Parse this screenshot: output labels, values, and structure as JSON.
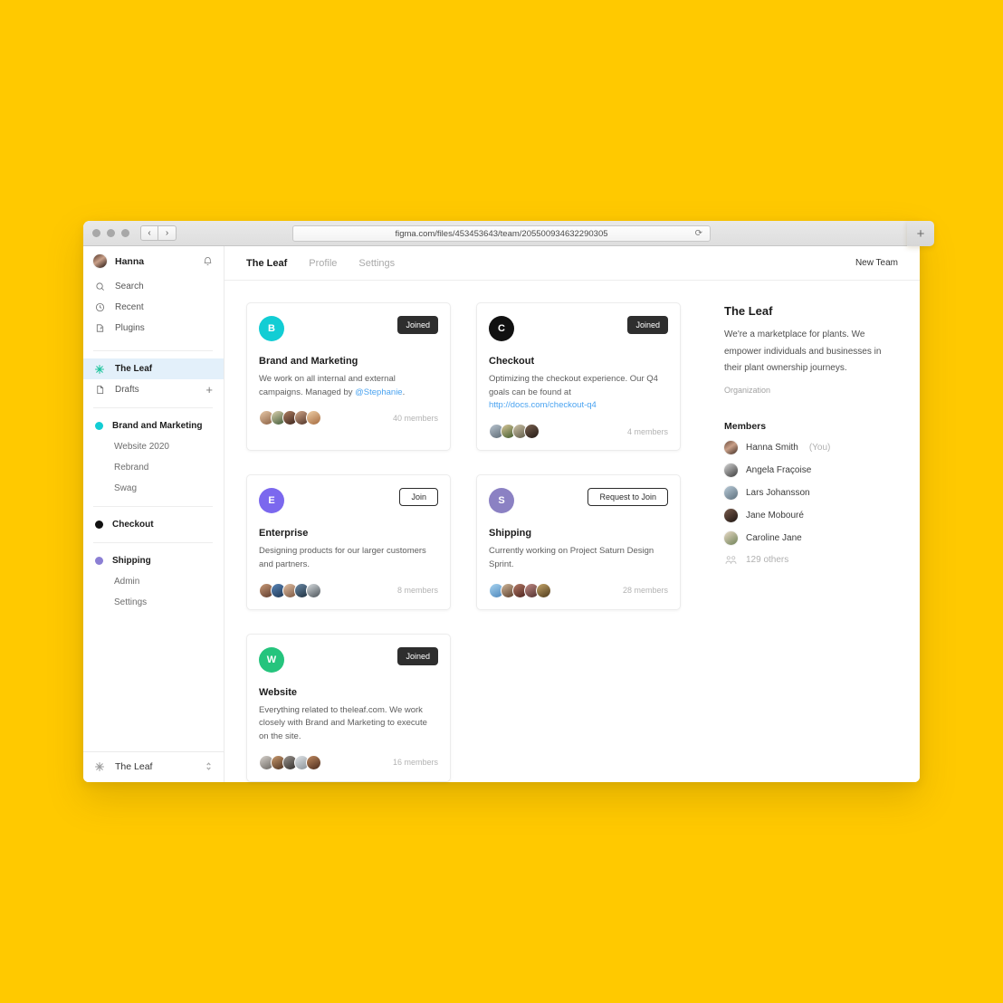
{
  "browser": {
    "url": "figma.com/files/453453643/team/205500934632290305",
    "back_label": "‹",
    "forward_label": "›",
    "reload_label": "⟳",
    "newtab_label": "+"
  },
  "sidebar": {
    "user": {
      "name": "Hanna",
      "bell_icon": "bell-icon"
    },
    "nav": [
      {
        "label": "Search",
        "icon": "search-icon"
      },
      {
        "label": "Recent",
        "icon": "clock-icon"
      },
      {
        "label": "Plugins",
        "icon": "plugin-icon"
      }
    ],
    "workspace": [
      {
        "label": "The Leaf",
        "icon": "asterisk-icon",
        "active": true
      },
      {
        "label": "Drafts",
        "icon": "file-icon",
        "plus": "+",
        "active": false
      }
    ],
    "teams": [
      {
        "name": "Brand and Marketing",
        "color": "#12CDD4",
        "projects": [
          "Website 2020",
          "Rebrand",
          "Swag"
        ]
      },
      {
        "name": "Checkout",
        "color": "#111111",
        "projects": []
      },
      {
        "name": "Shipping",
        "color": "#8B7FD4",
        "projects": [
          "Admin",
          "Settings"
        ]
      }
    ],
    "footer": {
      "label": "The Leaf",
      "icon": "asterisk-icon",
      "chevron": "⌃\n⌄"
    }
  },
  "topbar": {
    "tabs": [
      {
        "label": "The Leaf",
        "active": true
      },
      {
        "label": "Profile",
        "active": false
      },
      {
        "label": "Settings",
        "active": false
      }
    ],
    "new_team_label": "New Team"
  },
  "cards": [
    {
      "initial": "B",
      "color": "#12CDD4",
      "title": "Brand and Marketing",
      "desc_before": "We work on all internal and external campaigns. Managed by ",
      "link": "@Stephanie",
      "desc_after": ".",
      "button": "Joined",
      "button_style": "solid",
      "members": "40 members",
      "faces": [
        "#caa07c",
        "#3f5a37",
        "#4a2e28",
        "#6a4a3c",
        "#d8a47a"
      ]
    },
    {
      "initial": "C",
      "color": "#111111",
      "title": "Checkout",
      "desc_before": "Optimizing the checkout experience. Our Q4 goals can be found at ",
      "link": "http://docs.com/checkout-q4",
      "desc_after": "",
      "button": "Joined",
      "button_style": "solid",
      "members": "4 members",
      "faces": [
        "#8a96a3",
        "#4c6a3a",
        "#6e6a58",
        "#3b2f2a"
      ]
    },
    {
      "initial": "E",
      "color": "#7B68EE",
      "title": "Enterprise",
      "desc_before": "Designing products for our larger customers and partners.",
      "link": "",
      "desc_after": "",
      "button": "Join",
      "button_style": "outline",
      "members": "8 members",
      "faces": [
        "#9a6a52",
        "#2f4f7a",
        "#b08a72",
        "#2e4258",
        "#6f7a82"
      ]
    },
    {
      "initial": "S",
      "color": "#8B81C3",
      "title": "Shipping",
      "desc_before": "Currently working on Project Saturn Design Sprint.",
      "link": "",
      "desc_after": "",
      "button": "Request to Join",
      "button_style": "outline",
      "members": "28 members",
      "faces": [
        "#7fb0e0",
        "#8a6a52",
        "#73413a",
        "#7a4c4a",
        "#7c6a3c"
      ]
    },
    {
      "initial": "W",
      "color": "#25C47D",
      "title": "Website",
      "desc_before": "Everything related to theleaf.com. We work closely with Brand and Marketing to execute on the site.",
      "link": "",
      "desc_after": "",
      "button": "Joined",
      "button_style": "solid",
      "members": "16 members",
      "faces": [
        "#8e8b86",
        "#6b4a34",
        "#4e4a46",
        "#9aa0a6",
        "#6a4233"
      ]
    }
  ],
  "rail": {
    "title": "The Leaf",
    "description": "We're a marketplace for plants. We empower individuals and businesses in their plant ownership journeys.",
    "org_label": "Organization",
    "members_heading": "Members",
    "members": [
      {
        "name": "Hanna Smith",
        "tag": "(You)",
        "color": "#5a3d30"
      },
      {
        "name": "Angela Fraçoise",
        "tag": "",
        "color": "#4a4a4a"
      },
      {
        "name": "Lars Johansson",
        "tag": "",
        "color": "#7b8a95"
      },
      {
        "name": "Jane Mobouré",
        "tag": "",
        "color": "#2e2220"
      },
      {
        "name": "Caroline Jane",
        "tag": "",
        "color": "#9aa88c"
      }
    ],
    "others_label": "129 others",
    "others_icon": "people-icon"
  }
}
